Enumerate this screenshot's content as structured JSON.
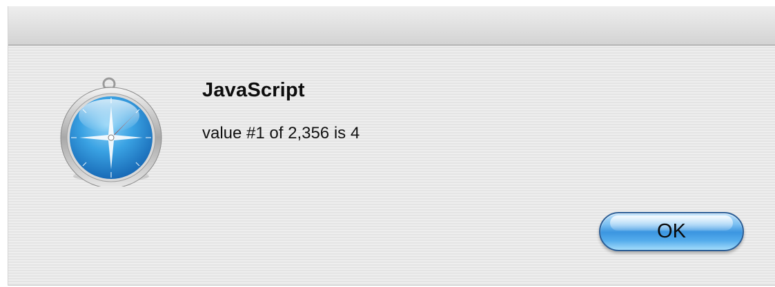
{
  "dialog": {
    "title": "JavaScript",
    "message": "value #1 of 2,356 is 4",
    "ok_label": "OK",
    "icon": "safari-compass-icon"
  },
  "colors": {
    "button_blue": "#3b95e0",
    "compass_blue": "#2f8fd6",
    "needle_red": "#e0452c"
  }
}
